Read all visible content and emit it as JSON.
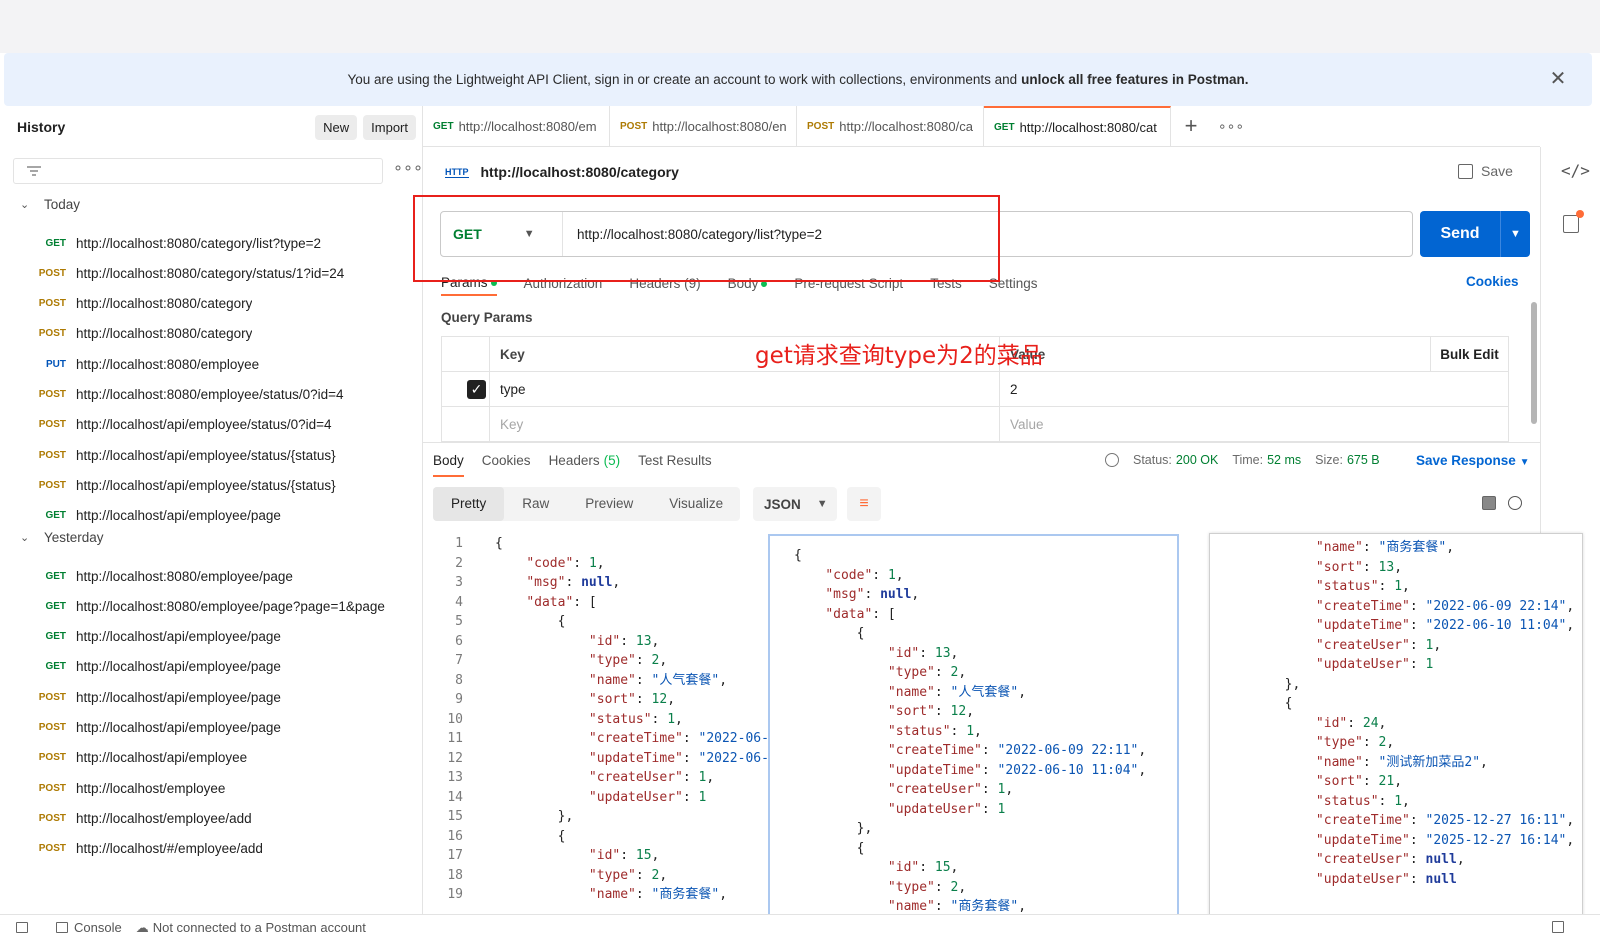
{
  "banner": {
    "text": "You are using the Lightweight API Client, sign in or create an account to work with collections, environments and",
    "bold": "unlock all free features in Postman.",
    "close": "✕"
  },
  "sidebar": {
    "title": "History",
    "new_label": "New",
    "import_label": "Import",
    "more": "∘∘∘",
    "groups": [
      {
        "label": "Today",
        "items": [
          {
            "method": "GET",
            "url": "http://localhost:8080/category/list?type=2"
          },
          {
            "method": "POST",
            "url": "http://localhost:8080/category/status/1?id=24"
          },
          {
            "method": "POST",
            "url": "http://localhost:8080/category"
          },
          {
            "method": "POST",
            "url": "http://localhost:8080/category"
          },
          {
            "method": "PUT",
            "url": "http://localhost:8080/employee"
          },
          {
            "method": "POST",
            "url": "http://localhost:8080/employee/status/0?id=4"
          },
          {
            "method": "POST",
            "url": "http://localhost/api/employee/status/0?id=4"
          },
          {
            "method": "POST",
            "url": "http://localhost/api/employee/status/{status}"
          },
          {
            "method": "POST",
            "url": "http://localhost/api/employee/status/{status}"
          },
          {
            "method": "GET",
            "url": "http://localhost/api/employee/page"
          }
        ]
      },
      {
        "label": "Yesterday",
        "items": [
          {
            "method": "GET",
            "url": "http://localhost:8080/employee/page"
          },
          {
            "method": "GET",
            "url": "http://localhost:8080/employee/page?page=1&page"
          },
          {
            "method": "GET",
            "url": "http://localhost/api/employee/page"
          },
          {
            "method": "GET",
            "url": "http://localhost/api/employee/page"
          },
          {
            "method": "POST",
            "url": "http://localhost/api/employee/page"
          },
          {
            "method": "POST",
            "url": "http://localhost/api/employee/page"
          },
          {
            "method": "POST",
            "url": "http://localhost/api/employee"
          },
          {
            "method": "POST",
            "url": "http://localhost/employee"
          },
          {
            "method": "POST",
            "url": "http://localhost/employee/add"
          },
          {
            "method": "POST",
            "url": "http://localhost/#/employee/add"
          }
        ]
      }
    ]
  },
  "tabs": [
    {
      "method": "GET",
      "url": "http://localhost:8080/em"
    },
    {
      "method": "POST",
      "url": "http://localhost:8080/en"
    },
    {
      "method": "POST",
      "url": "http://localhost:8080/ca"
    },
    {
      "method": "GET",
      "url": "http://localhost:8080/cat"
    }
  ],
  "tab_add": "+",
  "tab_more": "∘∘∘",
  "request": {
    "icon_text": "HTTP",
    "title": "http://localhost:8080/category",
    "save_label": "Save",
    "method": "GET",
    "url": "http://localhost:8080/category/list?type=2",
    "send_label": "Send",
    "tabs": [
      {
        "label": "Params",
        "dot": true,
        "active": true
      },
      {
        "label": "Authorization",
        "dot": false,
        "active": false
      },
      {
        "label": "Headers (9)",
        "dot": false,
        "active": false
      },
      {
        "label": "Body",
        "dot": true,
        "active": false
      },
      {
        "label": "Pre-request Script",
        "dot": false,
        "active": false
      },
      {
        "label": "Tests",
        "dot": false,
        "active": false
      },
      {
        "label": "Settings",
        "dot": false,
        "active": false
      }
    ],
    "cookies_label": "Cookies",
    "query_params_title": "Query Params",
    "params_table": {
      "key_header": "Key",
      "value_header": "Value",
      "bulk_edit": "Bulk Edit",
      "rows": [
        {
          "key": "type",
          "value": "2",
          "checked": true
        }
      ],
      "key_placeholder": "Key",
      "value_placeholder": "Value"
    }
  },
  "annotation": {
    "text": "get请求查询type为2的菜品",
    "color": "#e8201b"
  },
  "response": {
    "tabs": [
      {
        "label": "Body",
        "count": "",
        "active": true
      },
      {
        "label": "Cookies",
        "count": "",
        "active": false
      },
      {
        "label": "Headers",
        "count": "(5)",
        "active": false
      },
      {
        "label": "Test Results",
        "count": "",
        "active": false
      }
    ],
    "status_label": "Status:",
    "status_value": "200 OK",
    "time_label": "Time:",
    "time_value": "52 ms",
    "size_label": "Size:",
    "size_value": "675 B",
    "save_response": "Save Response",
    "formats": [
      "Pretty",
      "Raw",
      "Preview",
      "Visualize"
    ],
    "active_format": "Pretty",
    "language": "JSON",
    "wrap_icon": "≡"
  },
  "code_main": [
    [
      [
        "p",
        "{"
      ]
    ],
    [
      [
        "p",
        "    "
      ],
      [
        "k",
        "\"code\""
      ],
      [
        "p",
        ": "
      ],
      [
        "n",
        "1"
      ],
      [
        "p",
        ","
      ]
    ],
    [
      [
        "p",
        "    "
      ],
      [
        "k",
        "\"msg\""
      ],
      [
        "p",
        ": "
      ],
      [
        "z",
        "null"
      ],
      [
        "p",
        ","
      ]
    ],
    [
      [
        "p",
        "    "
      ],
      [
        "k",
        "\"data\""
      ],
      [
        "p",
        ": ["
      ]
    ],
    [
      [
        "p",
        "        {"
      ]
    ],
    [
      [
        "p",
        "            "
      ],
      [
        "k",
        "\"id\""
      ],
      [
        "p",
        ": "
      ],
      [
        "n",
        "13"
      ],
      [
        "p",
        ","
      ]
    ],
    [
      [
        "p",
        "            "
      ],
      [
        "k",
        "\"type\""
      ],
      [
        "p",
        ": "
      ],
      [
        "n",
        "2"
      ],
      [
        "p",
        ","
      ]
    ],
    [
      [
        "p",
        "            "
      ],
      [
        "k",
        "\"name\""
      ],
      [
        "p",
        ": "
      ],
      [
        "s",
        "\"人气套餐\""
      ],
      [
        "p",
        ","
      ]
    ],
    [
      [
        "p",
        "            "
      ],
      [
        "k",
        "\"sort\""
      ],
      [
        "p",
        ": "
      ],
      [
        "n",
        "12"
      ],
      [
        "p",
        ","
      ]
    ],
    [
      [
        "p",
        "            "
      ],
      [
        "k",
        "\"status\""
      ],
      [
        "p",
        ": "
      ],
      [
        "n",
        "1"
      ],
      [
        "p",
        ","
      ]
    ],
    [
      [
        "p",
        "            "
      ],
      [
        "k",
        "\"createTime\""
      ],
      [
        "p",
        ": "
      ],
      [
        "s",
        "\"2022-06-"
      ]
    ],
    [
      [
        "p",
        "            "
      ],
      [
        "k",
        "\"updateTime\""
      ],
      [
        "p",
        ": "
      ],
      [
        "s",
        "\"2022-06-"
      ]
    ],
    [
      [
        "p",
        "            "
      ],
      [
        "k",
        "\"createUser\""
      ],
      [
        "p",
        ": "
      ],
      [
        "n",
        "1"
      ],
      [
        "p",
        ","
      ]
    ],
    [
      [
        "p",
        "            "
      ],
      [
        "k",
        "\"updateUser\""
      ],
      [
        "p",
        ": "
      ],
      [
        "n",
        "1"
      ]
    ],
    [
      [
        "p",
        "        },"
      ]
    ],
    [
      [
        "p",
        "        {"
      ]
    ],
    [
      [
        "p",
        "            "
      ],
      [
        "k",
        "\"id\""
      ],
      [
        "p",
        ": "
      ],
      [
        "n",
        "15"
      ],
      [
        "p",
        ","
      ]
    ],
    [
      [
        "p",
        "            "
      ],
      [
        "k",
        "\"type\""
      ],
      [
        "p",
        ": "
      ],
      [
        "n",
        "2"
      ],
      [
        "p",
        ","
      ]
    ],
    [
      [
        "p",
        "            "
      ],
      [
        "k",
        "\"name\""
      ],
      [
        "p",
        ": "
      ],
      [
        "s",
        "\"商务套餐\""
      ],
      [
        "p",
        ","
      ]
    ]
  ],
  "code_mid": [
    [
      [
        "p",
        "{"
      ]
    ],
    [
      [
        "p",
        "    "
      ],
      [
        "k",
        "\"code\""
      ],
      [
        "p",
        ": "
      ],
      [
        "n",
        "1"
      ],
      [
        "p",
        ","
      ]
    ],
    [
      [
        "p",
        "    "
      ],
      [
        "k",
        "\"msg\""
      ],
      [
        "p",
        ": "
      ],
      [
        "z",
        "null"
      ],
      [
        "p",
        ","
      ]
    ],
    [
      [
        "p",
        "    "
      ],
      [
        "k",
        "\"data\""
      ],
      [
        "p",
        ": ["
      ]
    ],
    [
      [
        "p",
        "        {"
      ]
    ],
    [
      [
        "p",
        "            "
      ],
      [
        "k",
        "\"id\""
      ],
      [
        "p",
        ": "
      ],
      [
        "n",
        "13"
      ],
      [
        "p",
        ","
      ]
    ],
    [
      [
        "p",
        "            "
      ],
      [
        "k",
        "\"type\""
      ],
      [
        "p",
        ": "
      ],
      [
        "n",
        "2"
      ],
      [
        "p",
        ","
      ]
    ],
    [
      [
        "p",
        "            "
      ],
      [
        "k",
        "\"name\""
      ],
      [
        "p",
        ": "
      ],
      [
        "s",
        "\"人气套餐\""
      ],
      [
        "p",
        ","
      ]
    ],
    [
      [
        "p",
        "            "
      ],
      [
        "k",
        "\"sort\""
      ],
      [
        "p",
        ": "
      ],
      [
        "n",
        "12"
      ],
      [
        "p",
        ","
      ]
    ],
    [
      [
        "p",
        "            "
      ],
      [
        "k",
        "\"status\""
      ],
      [
        "p",
        ": "
      ],
      [
        "n",
        "1"
      ],
      [
        "p",
        ","
      ]
    ],
    [
      [
        "p",
        "            "
      ],
      [
        "k",
        "\"createTime\""
      ],
      [
        "p",
        ": "
      ],
      [
        "s",
        "\"2022-06-09 22:11\""
      ],
      [
        "p",
        ","
      ]
    ],
    [
      [
        "p",
        "            "
      ],
      [
        "k",
        "\"updateTime\""
      ],
      [
        "p",
        ": "
      ],
      [
        "s",
        "\"2022-06-10 11:04\""
      ],
      [
        "p",
        ","
      ]
    ],
    [
      [
        "p",
        "            "
      ],
      [
        "k",
        "\"createUser\""
      ],
      [
        "p",
        ": "
      ],
      [
        "n",
        "1"
      ],
      [
        "p",
        ","
      ]
    ],
    [
      [
        "p",
        "            "
      ],
      [
        "k",
        "\"updateUser\""
      ],
      [
        "p",
        ": "
      ],
      [
        "n",
        "1"
      ]
    ],
    [
      [
        "p",
        "        },"
      ]
    ],
    [
      [
        "p",
        "        {"
      ]
    ],
    [
      [
        "p",
        "            "
      ],
      [
        "k",
        "\"id\""
      ],
      [
        "p",
        ": "
      ],
      [
        "n",
        "15"
      ],
      [
        "p",
        ","
      ]
    ],
    [
      [
        "p",
        "            "
      ],
      [
        "k",
        "\"type\""
      ],
      [
        "p",
        ": "
      ],
      [
        "n",
        "2"
      ],
      [
        "p",
        ","
      ]
    ],
    [
      [
        "p",
        "            "
      ],
      [
        "k",
        "\"name\""
      ],
      [
        "p",
        ": "
      ],
      [
        "s",
        "\"商务套餐\""
      ],
      [
        "p",
        ","
      ]
    ]
  ],
  "code_right": [
    [
      [
        "p",
        "            "
      ],
      [
        "k",
        "\"name\""
      ],
      [
        "p",
        ": "
      ],
      [
        "s",
        "\"商务套餐\""
      ],
      [
        "p",
        ","
      ]
    ],
    [
      [
        "p",
        "            "
      ],
      [
        "k",
        "\"sort\""
      ],
      [
        "p",
        ": "
      ],
      [
        "n",
        "13"
      ],
      [
        "p",
        ","
      ]
    ],
    [
      [
        "p",
        "            "
      ],
      [
        "k",
        "\"status\""
      ],
      [
        "p",
        ": "
      ],
      [
        "n",
        "1"
      ],
      [
        "p",
        ","
      ]
    ],
    [
      [
        "p",
        "            "
      ],
      [
        "k",
        "\"createTime\""
      ],
      [
        "p",
        ": "
      ],
      [
        "s",
        "\"2022-06-09 22:14\""
      ],
      [
        "p",
        ","
      ]
    ],
    [
      [
        "p",
        "            "
      ],
      [
        "k",
        "\"updateTime\""
      ],
      [
        "p",
        ": "
      ],
      [
        "s",
        "\"2022-06-10 11:04\""
      ],
      [
        "p",
        ","
      ]
    ],
    [
      [
        "p",
        "            "
      ],
      [
        "k",
        "\"createUser\""
      ],
      [
        "p",
        ": "
      ],
      [
        "n",
        "1"
      ],
      [
        "p",
        ","
      ]
    ],
    [
      [
        "p",
        "            "
      ],
      [
        "k",
        "\"updateUser\""
      ],
      [
        "p",
        ": "
      ],
      [
        "n",
        "1"
      ]
    ],
    [
      [
        "p",
        "        },"
      ]
    ],
    [
      [
        "p",
        "        {"
      ]
    ],
    [
      [
        "p",
        "            "
      ],
      [
        "k",
        "\"id\""
      ],
      [
        "p",
        ": "
      ],
      [
        "n",
        "24"
      ],
      [
        "p",
        ","
      ]
    ],
    [
      [
        "p",
        "            "
      ],
      [
        "k",
        "\"type\""
      ],
      [
        "p",
        ": "
      ],
      [
        "n",
        "2"
      ],
      [
        "p",
        ","
      ]
    ],
    [
      [
        "p",
        "            "
      ],
      [
        "k",
        "\"name\""
      ],
      [
        "p",
        ": "
      ],
      [
        "s",
        "\"测试新加菜品2\""
      ],
      [
        "p",
        ","
      ]
    ],
    [
      [
        "p",
        "            "
      ],
      [
        "k",
        "\"sort\""
      ],
      [
        "p",
        ": "
      ],
      [
        "n",
        "21"
      ],
      [
        "p",
        ","
      ]
    ],
    [
      [
        "p",
        "            "
      ],
      [
        "k",
        "\"status\""
      ],
      [
        "p",
        ": "
      ],
      [
        "n",
        "1"
      ],
      [
        "p",
        ","
      ]
    ],
    [
      [
        "p",
        "            "
      ],
      [
        "k",
        "\"createTime\""
      ],
      [
        "p",
        ": "
      ],
      [
        "s",
        "\"2025-12-27 16:11\""
      ],
      [
        "p",
        ","
      ]
    ],
    [
      [
        "p",
        "            "
      ],
      [
        "k",
        "\"updateTime\""
      ],
      [
        "p",
        ": "
      ],
      [
        "s",
        "\"2025-12-27 16:14\""
      ],
      [
        "p",
        ","
      ]
    ],
    [
      [
        "p",
        "            "
      ],
      [
        "k",
        "\"createUser\""
      ],
      [
        "p",
        ": "
      ],
      [
        "z",
        "null"
      ],
      [
        "p",
        ","
      ]
    ],
    [
      [
        "p",
        "            "
      ],
      [
        "k",
        "\"updateUser\""
      ],
      [
        "p",
        ": "
      ],
      [
        "z",
        "null"
      ]
    ]
  ],
  "statusbar": {
    "console": "Console",
    "connection": "Not connected to a Postman account"
  }
}
